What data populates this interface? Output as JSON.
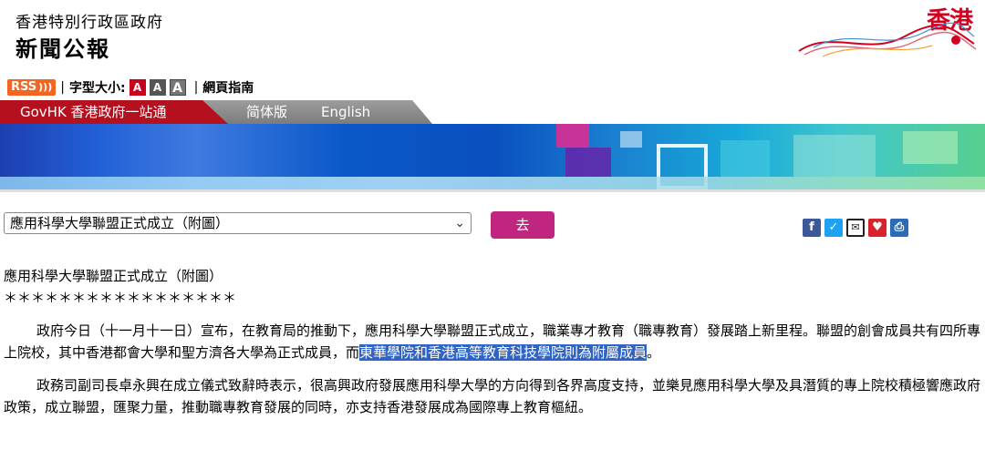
{
  "header": {
    "gov_name": "香港特別行政區政府",
    "press_title": "新聞公報",
    "brand_text": "香港"
  },
  "util_bar": {
    "rss_label": "RSS",
    "separator": "|",
    "font_size_label": "字型大小:",
    "font_size_options": [
      "A",
      "A",
      "A"
    ],
    "site_guide": "網頁指南"
  },
  "nav": {
    "govhk": "GovHK 香港政府一站通",
    "simplified": "简体版",
    "english": "English"
  },
  "toolbar": {
    "select_value": "應用科學大學聯盟正式成立（附圖）",
    "go_label": "去",
    "share_icons": [
      "facebook-icon",
      "twitter-icon",
      "email-icon",
      "bookmark-icon",
      "print-icon"
    ]
  },
  "article": {
    "title": "應用科學大學聯盟正式成立（附圖）",
    "stars": "＊＊＊＊＊＊＊＊＊＊＊＊＊＊＊＊＊",
    "p1_before": "政府今日（十一月十一日）宣布，在教育局的推動下，應用科學大學聯盟正式成立，職業專才教育（職專教育）發展踏上新里程。聯盟的創會成員共有四所專上院校，其中香港都會大學和聖方濟各大學為正式成員，而",
    "p1_highlight": "東華學院和香港高等教育科技學院則為附屬成員",
    "p1_after": "。",
    "p2": "政務司副司長卓永興在成立儀式致辭時表示，很高興政府發展應用科學大學的方向得到各界高度支持，並樂見應用科學大學及具潛質的專上院校積極響應政府政策，成立聯盟，匯聚力量，推動職專教育發展的同時，亦支持香港發展成為國際專上教育樞紐。"
  },
  "colors": {
    "govhk_red": "#b5101e",
    "go_button": "#c0267f",
    "highlight": "#2f63c5",
    "brand_red": "#d4001f"
  }
}
